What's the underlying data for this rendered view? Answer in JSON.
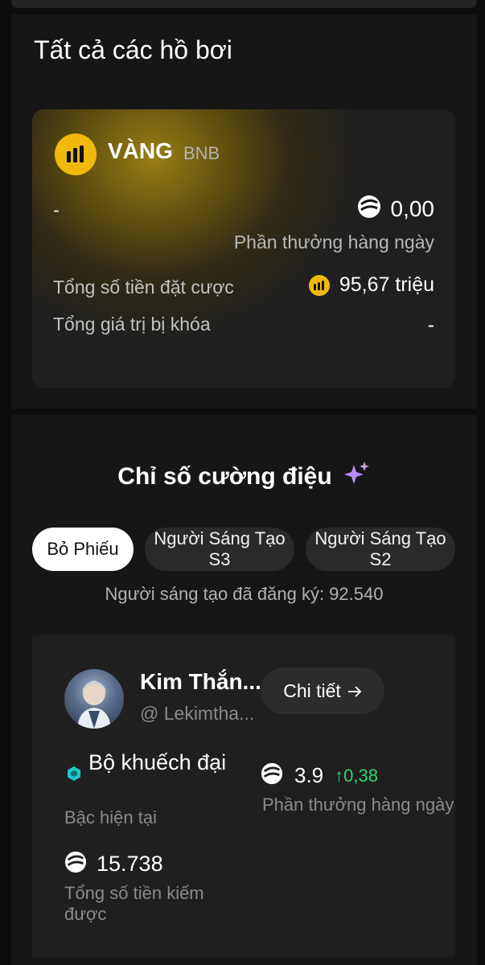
{
  "pools": {
    "title": "Tất cả các hồ bơi",
    "card": {
      "name": "VÀNG",
      "ticker": "BNB",
      "left_value": "-",
      "daily_reward_value": "0,00",
      "daily_reward_label": "Phần thưởng hàng ngày",
      "total_staked_label": "Tổng số tiền đặt cược",
      "total_staked_value": "95,67 triệu",
      "tvl_label": "Tổng giá trị bị khóa",
      "tvl_value": "-",
      "accent_color": "#f0b90b"
    }
  },
  "hype": {
    "title": "Chỉ số cường điệu",
    "title_icon": "sparkles-icon",
    "tabs": [
      {
        "label": "Bỏ Phiếu",
        "active": true
      },
      {
        "label": "Người Sáng Tạo S3",
        "active": false
      },
      {
        "label": "Người Sáng Tạo S2",
        "active": false
      }
    ],
    "registered_text": "Người sáng tạo đã đăng ký: 92.540",
    "creator": {
      "name": "Kim Thắn...",
      "handle": "@ Lekimtha...",
      "detail_label": "Chi tiết",
      "tier_name": "Bộ khuếch đại",
      "tier_label": "Bậc hiện tại",
      "daily_value": "3.9",
      "daily_change": "0,38",
      "daily_label": "Phần thưởng hàng ngày",
      "earned_value": "15.738",
      "earned_label": "Tổng số tiền kiếm được",
      "change_color": "#2ed573",
      "tier_color": "#1ec8c8"
    }
  }
}
